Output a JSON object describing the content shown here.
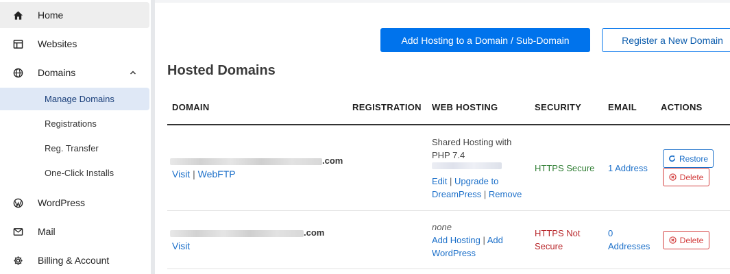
{
  "sidebar": {
    "items": [
      {
        "label": "Home",
        "icon": "home-icon"
      },
      {
        "label": "Websites",
        "icon": "websites-icon"
      },
      {
        "label": "Domains",
        "icon": "globe-icon"
      },
      {
        "label": "WordPress",
        "icon": "wordpress-icon"
      },
      {
        "label": "Mail",
        "icon": "mail-icon"
      },
      {
        "label": "Billing & Account",
        "icon": "gear-icon"
      }
    ],
    "domains_sub": [
      {
        "label": "Manage Domains"
      },
      {
        "label": "Registrations"
      },
      {
        "label": "Reg. Transfer"
      },
      {
        "label": "One-Click Installs"
      }
    ]
  },
  "header": {
    "add_hosting_label": "Add Hosting to a Domain / Sub-Domain",
    "register_label": "Register a New Domain"
  },
  "main": {
    "title": "Hosted Domains",
    "columns": [
      "DOMAIN",
      "REGISTRATION",
      "WEB HOSTING",
      "SECURITY",
      "EMAIL",
      "ACTIONS"
    ]
  },
  "rows": [
    {
      "domain_suffix": ".com",
      "visit": "Visit",
      "sep": "|",
      "webftp": "WebFTP",
      "hosting_line1": "Shared Hosting with",
      "hosting_line2": "PHP 7.4",
      "edit": "Edit",
      "upgrade_line1": "Upgrade to",
      "upgrade_line2": "DreamPress",
      "remove": "Remove",
      "security": "HTTPS Secure",
      "email": "1 Address",
      "restore": "Restore",
      "delete": "Delete"
    },
    {
      "domain_suffix": ".com",
      "visit": "Visit",
      "hosting_none": "none",
      "add_hosting": "Add Hosting",
      "add_line1": "Add",
      "add_line2": "WordPress",
      "security_line1": "HTTPS Not",
      "security_line2": "Secure",
      "email_line1": "0",
      "email_line2": "Addresses",
      "delete": "Delete"
    }
  ],
  "colors": {
    "primary": "#0073ec",
    "link": "#1b6fc9",
    "secure": "#2e7d32",
    "insecure": "#b8262a",
    "danger": "#d23b3b",
    "active_sub_bg": "#dfe8f6"
  }
}
